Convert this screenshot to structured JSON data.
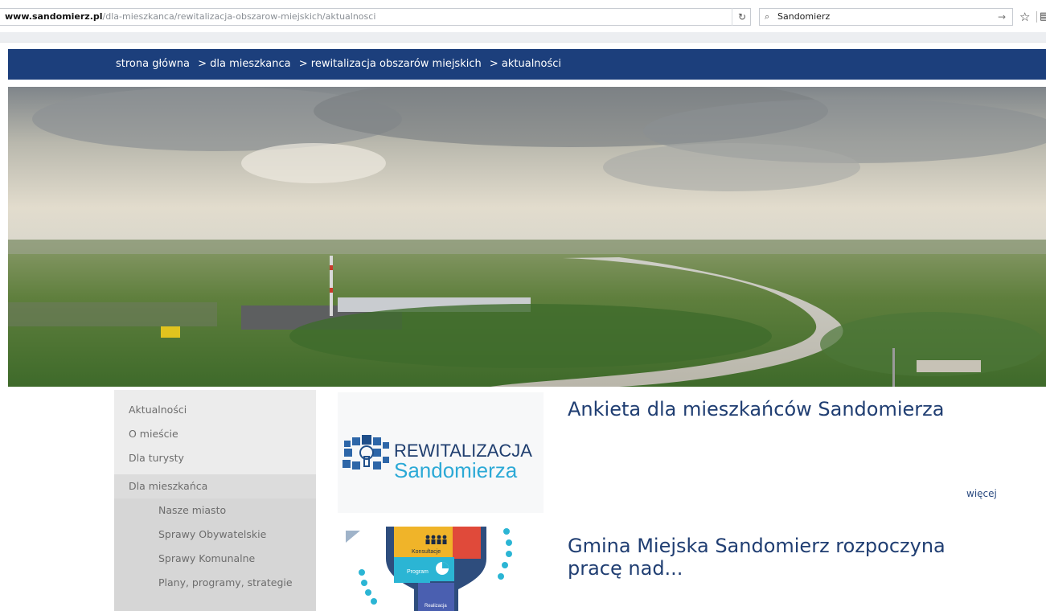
{
  "browser": {
    "url_domain": "www.sandomierz.pl",
    "url_path": "/dla-mieszkanca/rewitalizacja-obszarow-miejskich/aktualnosci",
    "search_value": "Sandomierz"
  },
  "breadcrumb": {
    "items": [
      "strona główna",
      "> dla mieszkanca",
      "> rewitalizacja obszarów miejskich",
      "> aktualności"
    ]
  },
  "sidebar": {
    "items": [
      {
        "label": "Aktualności"
      },
      {
        "label": "O mieście"
      },
      {
        "label": "Dla turysty"
      },
      {
        "label": "Dla mieszkańca"
      }
    ],
    "subitems": [
      {
        "label": "Nasze miasto"
      },
      {
        "label": "Sprawy Obywatelskie"
      },
      {
        "label": "Sprawy Komunalne"
      },
      {
        "label": "Plany, programy, strategie"
      }
    ]
  },
  "articles": [
    {
      "title": "Ankieta dla mieszkańców Sandomierza",
      "more_label": "więcej",
      "logo": {
        "line1": "REWITALIZACJA",
        "line2": "Sandomierza"
      }
    },
    {
      "title_line1": "Gmina Miejska Sandomierz rozpoczyna",
      "title_line2": "pracę nad...",
      "graphic": {
        "label_top": "Konsultacje",
        "label_mid": "Program",
        "label_bottom": "Realizacja"
      }
    }
  ],
  "colors": {
    "nav_blue": "#1c3f7c",
    "title_blue": "#203e72",
    "menu_bg": "#ececec"
  }
}
